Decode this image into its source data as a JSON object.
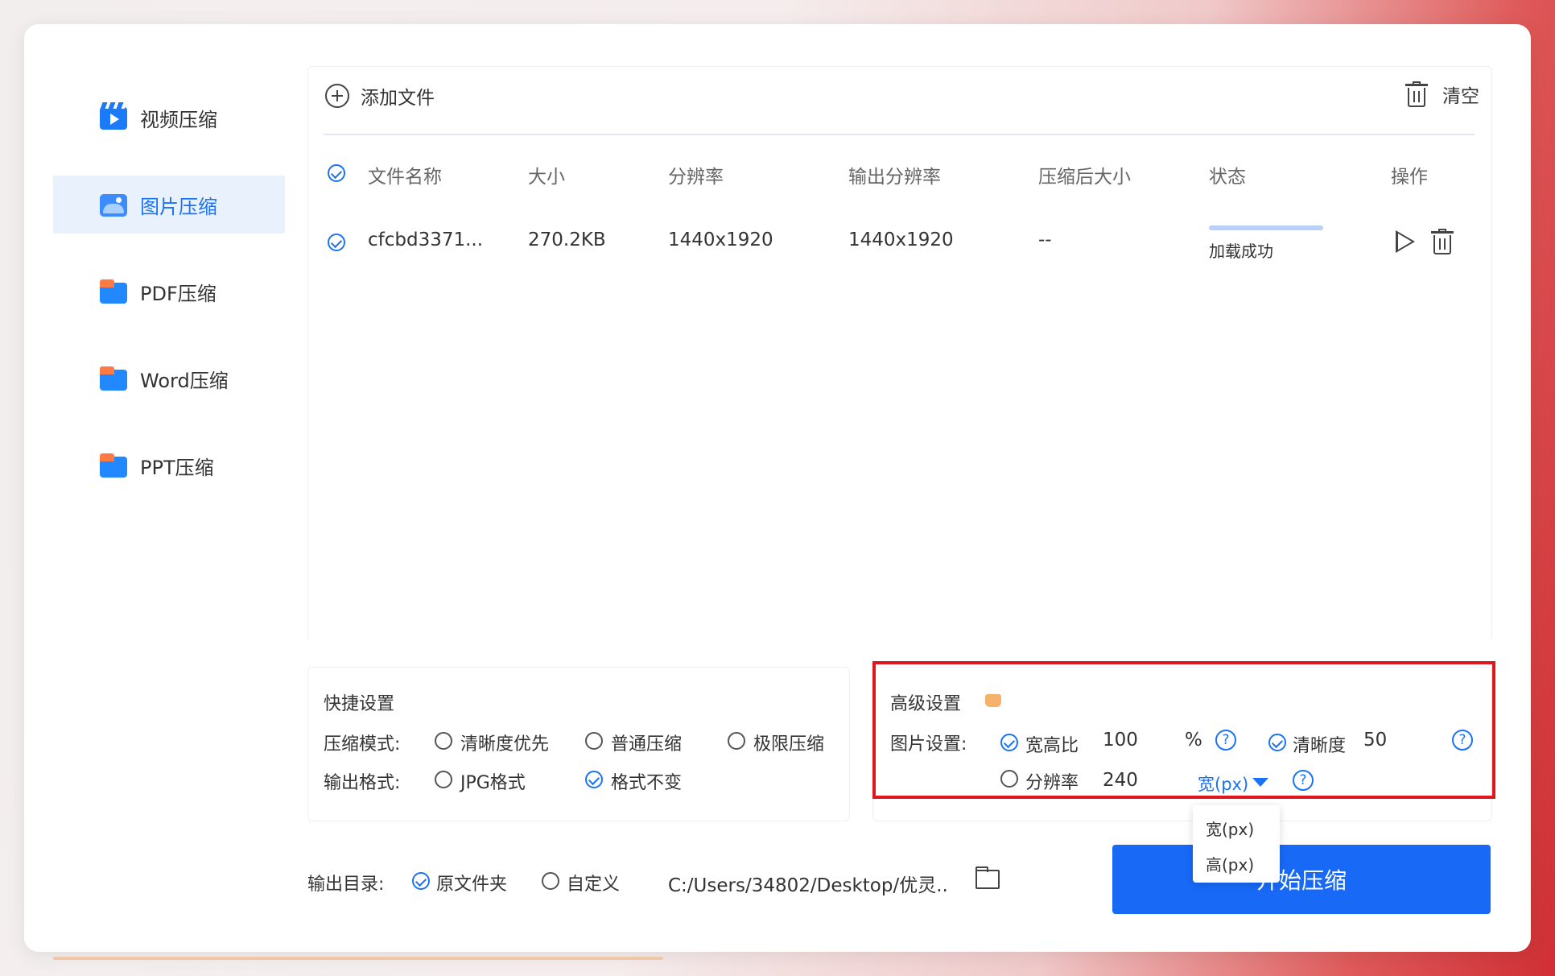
{
  "sidebar": {
    "items": [
      {
        "label": "视频压缩",
        "icon": "video-icon",
        "active": false
      },
      {
        "label": "图片压缩",
        "icon": "image-icon",
        "active": true
      },
      {
        "label": "PDF压缩",
        "icon": "folder-icon",
        "active": false
      },
      {
        "label": "Word压缩",
        "icon": "folder-icon",
        "active": false
      },
      {
        "label": "PPT压缩",
        "icon": "folder-icon",
        "active": false
      }
    ]
  },
  "toolbar": {
    "add_label": "添加文件",
    "clear_label": "清空"
  },
  "table": {
    "columns": [
      "文件名称",
      "大小",
      "分辨率",
      "输出分辨率",
      "压缩后大小",
      "状态",
      "操作"
    ],
    "rows": [
      {
        "name": "cfcbd3371...",
        "size": "270.2KB",
        "resolution": "1440x1920",
        "output_resolution": "1440x1920",
        "compressed_size": "--",
        "status": "加载成功",
        "progress": 1.0
      }
    ]
  },
  "quick_settings": {
    "title": "快捷设置",
    "mode_label": "压缩模式:",
    "modes": [
      "清晰度优先",
      "普通压缩",
      "极限压缩"
    ],
    "format_label": "输出格式:",
    "formats": [
      "JPG格式",
      "格式不变"
    ],
    "selected_format": "格式不变"
  },
  "advanced_settings": {
    "title": "高级设置",
    "image_label": "图片设置:",
    "ratio_label": "宽高比",
    "ratio_value": "100",
    "ratio_unit": "%",
    "clarity_label": "清晰度",
    "clarity_value": "50",
    "resolution_label": "分辨率",
    "resolution_value": "240",
    "dimension_selected": "宽(px)",
    "dimension_options": [
      "宽(px)",
      "高(px)"
    ],
    "help_glyph": "?"
  },
  "output": {
    "label": "输出目录:",
    "options": [
      "原文件夹",
      "自定义"
    ],
    "selected": "原文件夹",
    "path": "C:/Users/34802/Desktop/优灵.."
  },
  "start_button": {
    "label": "开始压缩"
  },
  "colors": {
    "accent": "#1a73f5",
    "highlight": "#e0161d",
    "button": "#1769f6"
  }
}
